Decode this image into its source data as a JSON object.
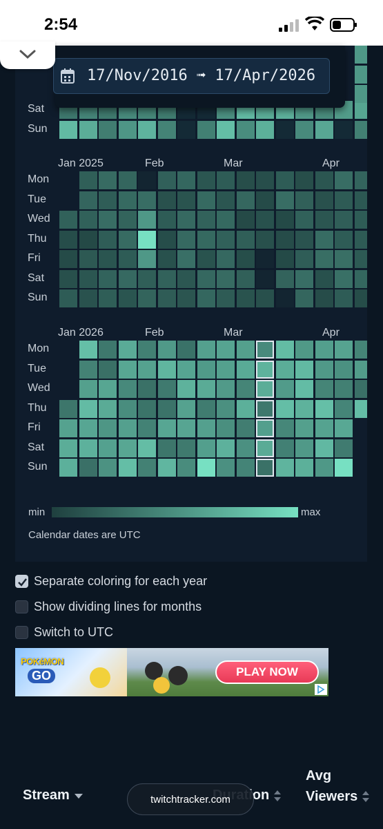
{
  "status_bar": {
    "time": "2:54"
  },
  "date_range": {
    "text": "17/Nov/2016 ➟ 17/Apr/2026"
  },
  "heatmap": {
    "days": [
      "Mon",
      "Tue",
      "Wed",
      "Thu",
      "Fri",
      "Sat",
      "Sun"
    ],
    "partial_days": [
      "Sat",
      "Sun"
    ],
    "years": [
      {
        "months": [
          "Jan 2025",
          "Feb",
          "Mar",
          "Apr"
        ]
      },
      {
        "months": [
          "Jan 2026",
          "Feb",
          "Mar",
          "Apr"
        ]
      }
    ],
    "legend_min": "min",
    "legend_max": "max",
    "note": "Calendar dates are UTC",
    "colors": {
      "empty": "#0f1c2c",
      "low": "#1f403f",
      "high": "#77e0c2",
      "selected_outline": "#dfe7ee"
    }
  },
  "options": {
    "separate_coloring": "Separate coloring for each year",
    "separate_coloring_checked": true,
    "dividing_lines": "Show dividing lines for months",
    "dividing_lines_checked": false,
    "switch_utc": "Switch to UTC",
    "switch_utc_checked": false
  },
  "ad": {
    "logo_top": "POKéMON",
    "logo_bottom": "GO",
    "cta": "PLAY NOW"
  },
  "table": {
    "col_stream": "Stream",
    "col_duration": "Duration",
    "col_avg_top": "Avg",
    "col_avg_bottom": "Viewers"
  },
  "url_pill": "twitchtracker.com"
}
